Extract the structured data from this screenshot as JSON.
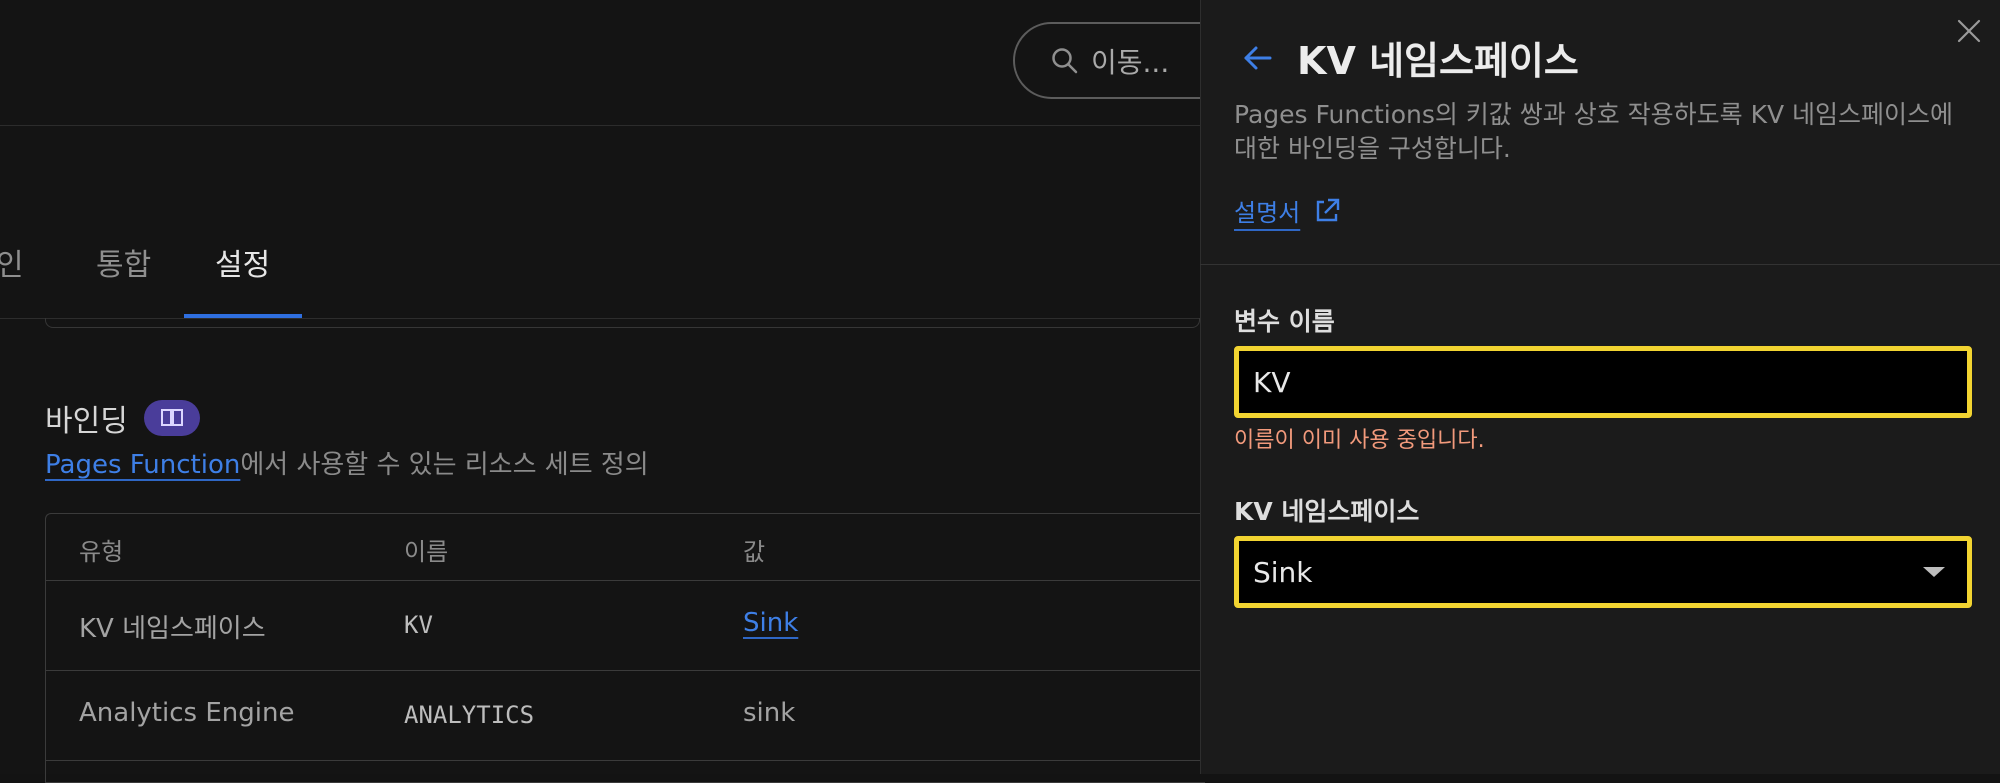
{
  "search": {
    "placeholder": "이동..."
  },
  "tabs": [
    {
      "label": "인"
    },
    {
      "label": "통합"
    },
    {
      "label": "설정",
      "active": true
    }
  ],
  "bindings_section": {
    "title": "바인딩",
    "description_link": "Pages Function",
    "description_rest": "에서 사용할 수 있는 리소스 세트 정의",
    "badge_icon": "book-icon"
  },
  "table": {
    "headers": [
      "유형",
      "이름",
      "값"
    ],
    "rows": [
      {
        "type": "KV 네임스페이스",
        "name": "KV",
        "value": "Sink",
        "value_is_link": true
      },
      {
        "type": "Analytics Engine",
        "name": "ANALYTICS",
        "value": "sink",
        "value_is_link": false
      }
    ]
  },
  "panel": {
    "title": "KV 네임스페이스",
    "description": "Pages Functions의 키값 쌍과 상호 작용하도록 KV 네임스페이스에 대한 바인딩을 구성합니다.",
    "docs_link": "설명서",
    "variable_label": "변수 이름",
    "variable_value": "KV",
    "error_message": "이름이 이미 사용 중입니다.",
    "namespace_label": "KV 네임스페이스",
    "namespace_selected": "Sink"
  },
  "colors": {
    "accent": "#3e7fe6",
    "focus_border": "#f2d431",
    "error": "#f29a7c",
    "badge": "#4a3d9a"
  }
}
